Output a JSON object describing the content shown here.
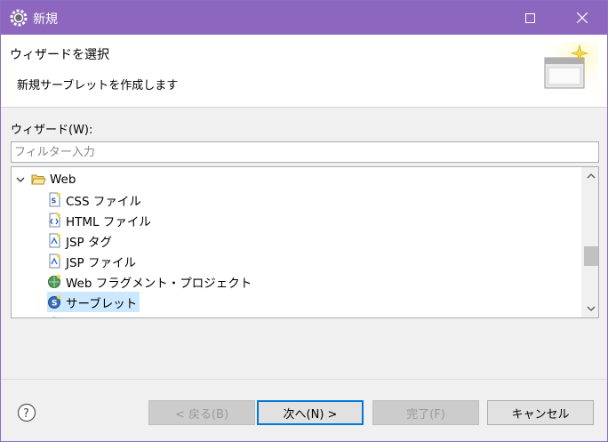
{
  "window": {
    "title": "新規"
  },
  "header": {
    "title": "ウィザードを選択",
    "description": "新規サーブレットを作成します"
  },
  "wizard_label": "ウィザード(W):",
  "filter": {
    "value": "",
    "placeholder": "フィルター入力"
  },
  "tree": {
    "items": [
      {
        "label": "Web",
        "icon": "folder-open-icon",
        "expanded": true
      },
      {
        "label": "CSS ファイル",
        "icon": "css-file-icon"
      },
      {
        "label": "HTML ファイル",
        "icon": "html-file-icon"
      },
      {
        "label": "JSP タグ",
        "icon": "jsp-tag-icon"
      },
      {
        "label": "JSP ファイル",
        "icon": "jsp-file-icon"
      },
      {
        "label": "Web フラグメント・プロジェクト",
        "icon": "web-fragment-project-icon"
      },
      {
        "label": "サーブレット",
        "icon": "servlet-icon",
        "selected": true
      }
    ]
  },
  "buttons": {
    "back": "< 戻る(B)",
    "next": "次へ(N) >",
    "finish": "完了(F)",
    "cancel": "キャンセル"
  },
  "colors": {
    "titlebar": "#8c67bd",
    "selection": "#cce8ff",
    "default_button_border": "#0078d7"
  }
}
